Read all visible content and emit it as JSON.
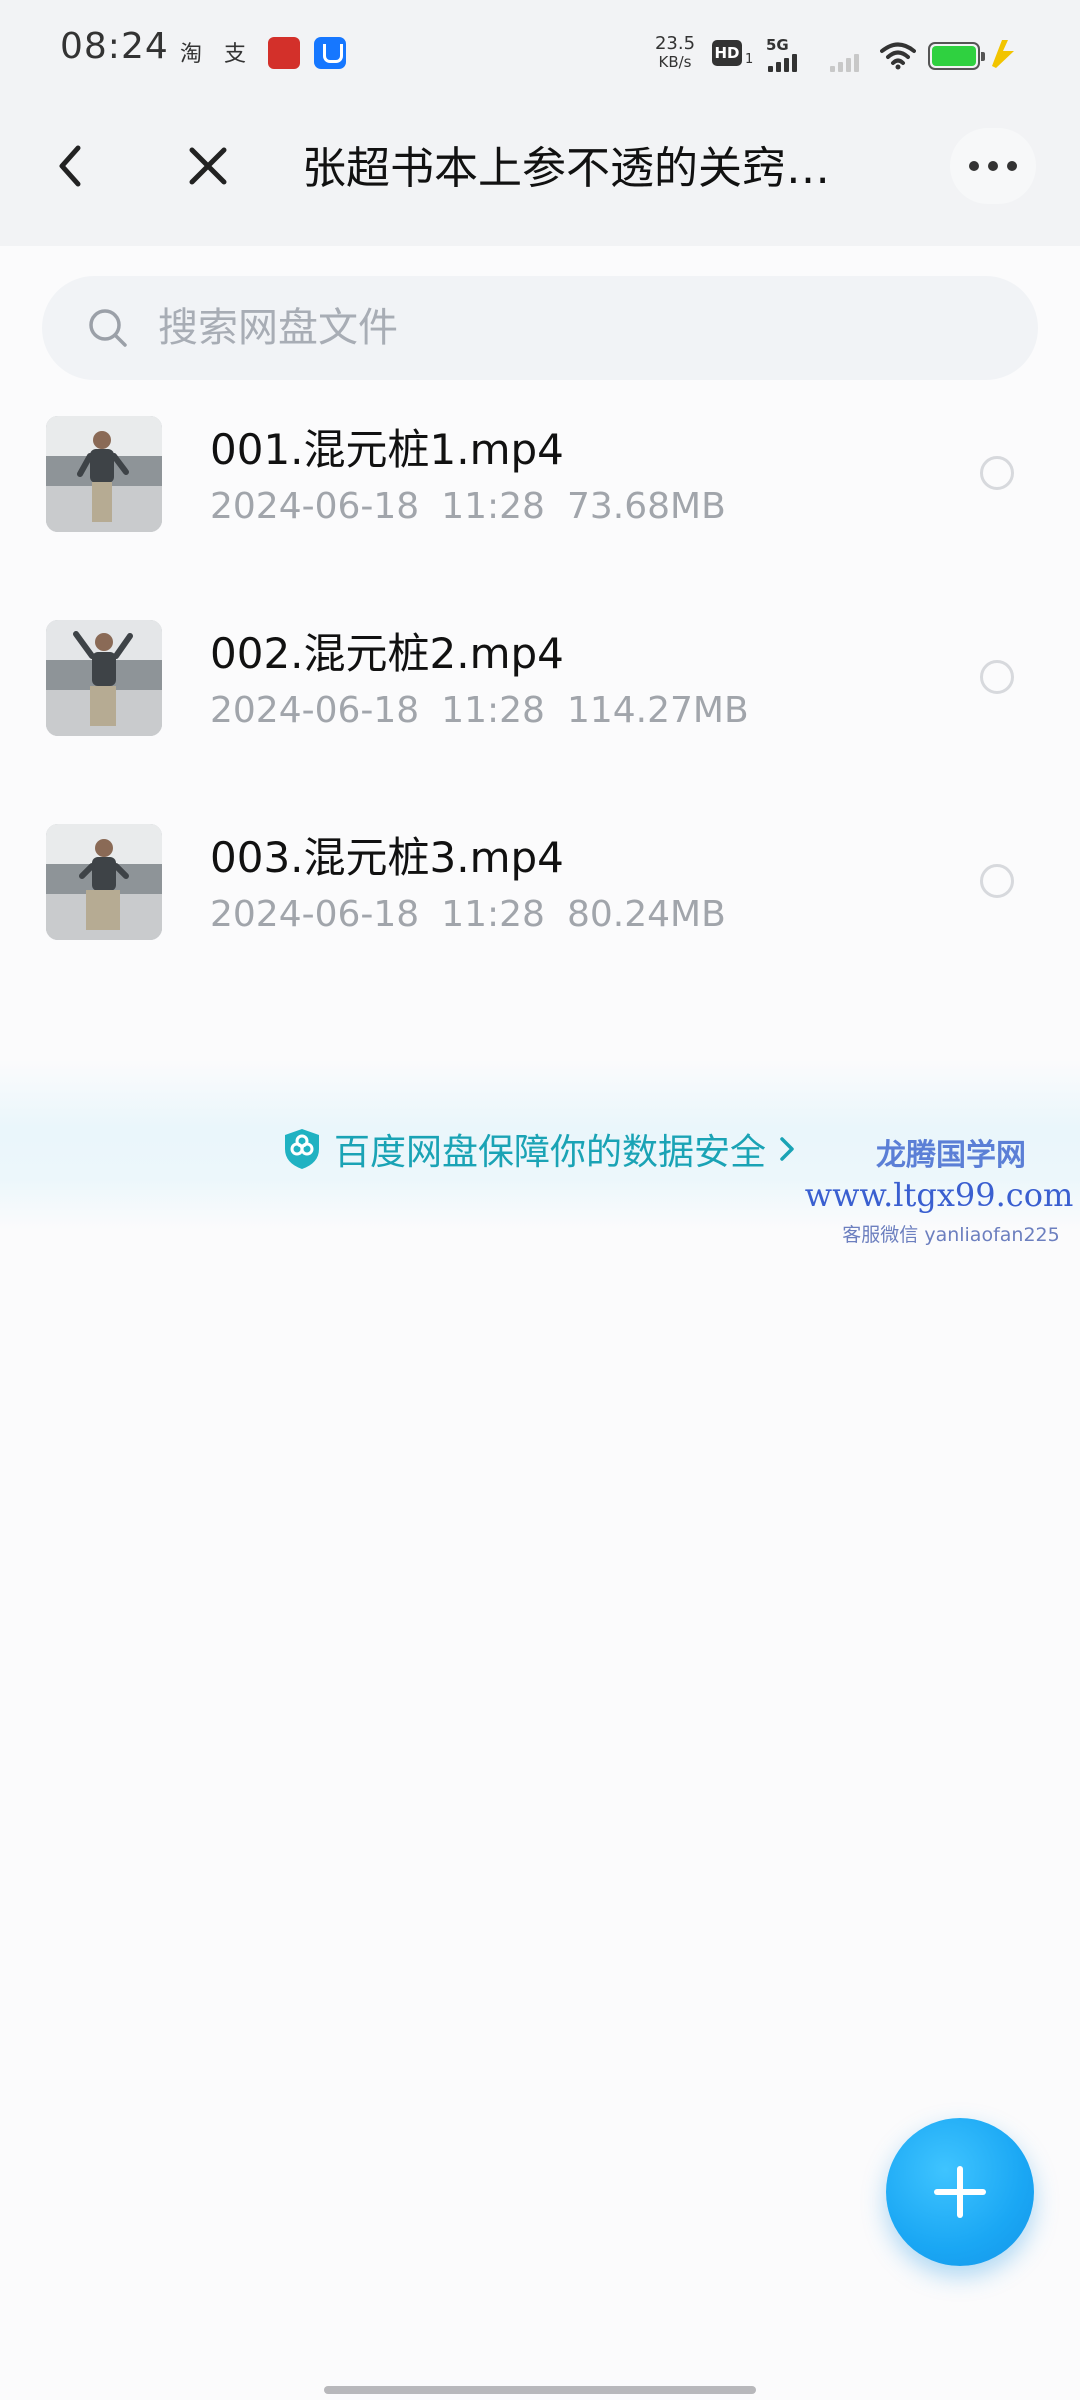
{
  "status_bar": {
    "time": "08:24",
    "app_icons": [
      "淘",
      "支"
    ],
    "net_speed_value": "23.5",
    "net_speed_unit": "KB/s",
    "hd_label": "HD",
    "hd_sub": "1",
    "network_label": "5G",
    "battery_color": "#2fd140"
  },
  "header": {
    "title": "张超书本上参不透的关窍…",
    "back_icon": "chevron-left-icon",
    "close_icon": "close-icon",
    "more_icon": "more-icon"
  },
  "search": {
    "placeholder": "搜索网盘文件",
    "value": ""
  },
  "files": [
    {
      "name": "001.混元桩1.mp4",
      "date": "2024-06-18",
      "time": "11:28",
      "size": "73.68MB"
    },
    {
      "name": "002.混元桩2.mp4",
      "date": "2024-06-18",
      "time": "11:28",
      "size": "114.27MB"
    },
    {
      "name": "003.混元桩3.mp4",
      "date": "2024-06-18",
      "time": "11:28",
      "size": "80.24MB"
    }
  ],
  "security_banner": {
    "text": "百度网盘保障你的数据安全",
    "color": "#1aa3b5"
  },
  "watermark": {
    "title": "龙腾国学网",
    "url": "www.ltgx99.com",
    "wechat": "客服微信 yanliaofan225"
  },
  "fab": {
    "icon": "plus-icon",
    "color": "#1aa7f4"
  }
}
